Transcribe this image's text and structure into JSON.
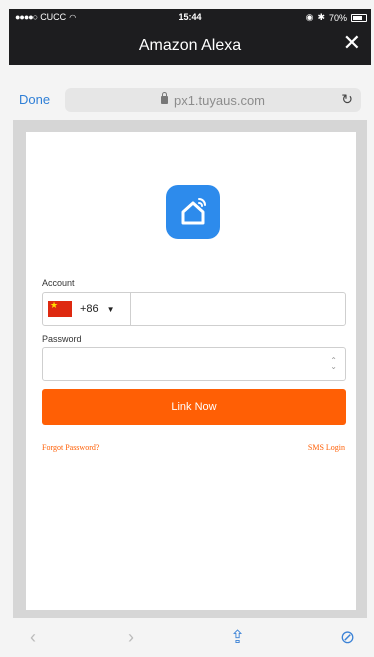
{
  "status_bar": {
    "carrier": "CUCC",
    "time": "15:44",
    "battery": "70%"
  },
  "window": {
    "title": "Amazon Alexa",
    "close_label": "✕"
  },
  "browser": {
    "done_label": "Done",
    "url": "px1.tuyaus.com"
  },
  "login": {
    "account_label": "Account",
    "country_code": "+86",
    "account_value": "",
    "password_label": "Password",
    "password_value": "",
    "submit_label": "Link Now",
    "forgot_label": "Forgot Password?",
    "sms_label": "SMS Login"
  },
  "colors": {
    "accent": "#ff5f05",
    "logo_blue": "#2d8bec",
    "link_blue": "#2f7fd6"
  },
  "icons": {
    "back": "chevron-left-icon",
    "forward": "chevron-right-icon",
    "share": "share-icon",
    "safari": "compass-icon",
    "reload": "reload-icon",
    "lock": "lock-icon"
  }
}
